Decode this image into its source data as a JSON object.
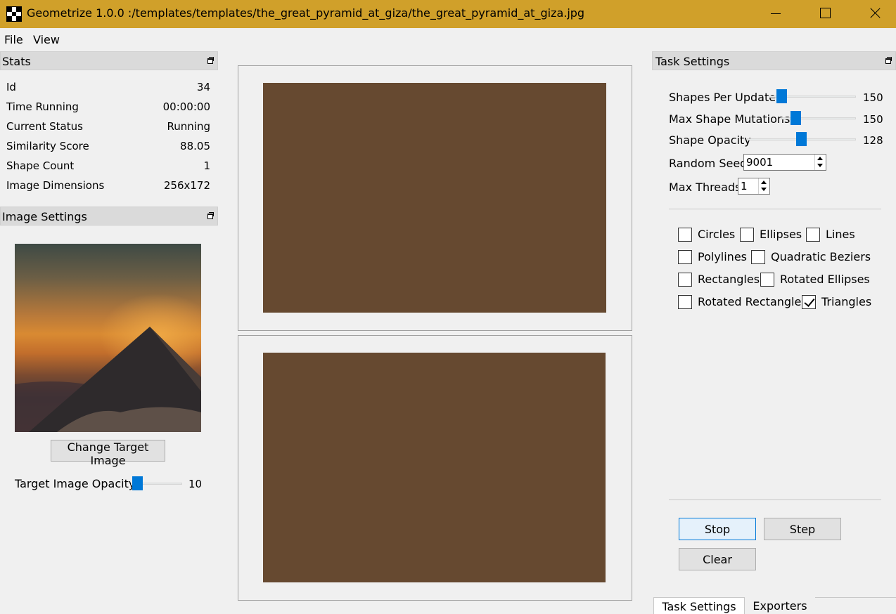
{
  "window": {
    "title": "Geometrize 1.0.0 :/templates/templates/the_great_pyramid_at_giza/the_great_pyramid_at_giza.jpg",
    "icons": [
      "app-icon",
      "minimize-icon",
      "maximize-icon",
      "close-icon"
    ]
  },
  "menu": {
    "file": "File",
    "view": "View"
  },
  "stats": {
    "title": "Stats",
    "rows": [
      {
        "label": "Id",
        "value": "34"
      },
      {
        "label": "Time Running",
        "value": "00:00:00"
      },
      {
        "label": "Current Status",
        "value": "Running"
      },
      {
        "label": "Similarity Score",
        "value": "88.05"
      },
      {
        "label": "Shape Count",
        "value": "1"
      },
      {
        "label": "Image Dimensions",
        "value": "256x172"
      }
    ]
  },
  "image_settings": {
    "title": "Image Settings",
    "change_button": "Change Target Image",
    "opacity_label": "Target Image Opacity",
    "opacity_value": "10",
    "opacity_fraction": 0.04
  },
  "canvas": {
    "fill_color": "#664930"
  },
  "task_settings": {
    "title": "Task Settings",
    "sliders": [
      {
        "label": "Shapes Per Update",
        "value": "150",
        "fraction": 0.1
      },
      {
        "label": "Max Shape Mutations",
        "value": "150",
        "fraction": 0.15
      },
      {
        "label": "Shape Opacity",
        "value": "128",
        "fraction": 0.5
      }
    ],
    "random_seed_label": "Random Seed",
    "random_seed_value": "9001",
    "max_threads_label": "Max Threads",
    "max_threads_value": "1",
    "shapes": [
      {
        "label": "Circles",
        "checked": false
      },
      {
        "label": "Ellipses",
        "checked": false
      },
      {
        "label": "Lines",
        "checked": false
      },
      {
        "label": "Polylines",
        "checked": false
      },
      {
        "label": "Quadratic Beziers",
        "checked": false
      },
      {
        "label": "Rectangles",
        "checked": false
      },
      {
        "label": "Rotated Ellipses",
        "checked": false
      },
      {
        "label": "Rotated Rectangles",
        "checked": false
      },
      {
        "label": "Triangles",
        "checked": true
      }
    ],
    "stop": "Stop",
    "step": "Step",
    "clear": "Clear"
  },
  "tabs": [
    {
      "label": "Task Settings",
      "active": true
    },
    {
      "label": "Exporters",
      "active": false
    }
  ]
}
